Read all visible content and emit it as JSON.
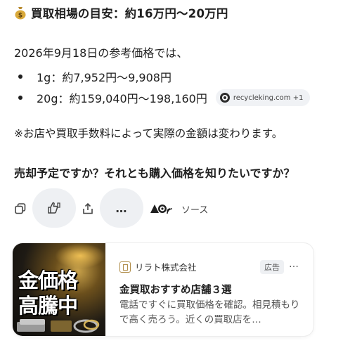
{
  "heading": {
    "icon": "money-bag-icon",
    "text": "買取相場の目安：約16万円～20万円"
  },
  "intro": "2026年9月18日の参考価格では、",
  "bullets": [
    {
      "text": "1g：約7,952円～9,908円"
    },
    {
      "text": "20g：約159,040円～198,160円",
      "source_chip": "recycleking.com +1"
    }
  ],
  "note": "※お店や買取手数料によって実際の金額は変わります。",
  "question": "売却予定ですか？それとも購入価格を知りたいですか？",
  "actions": {
    "copy_icon": "copy-icon",
    "feedback_icon": "thumbs-up-down-icon",
    "share_icon": "share-icon",
    "more_label": "…",
    "source_label": "ソース"
  },
  "ad": {
    "image_text_line1": "金価格",
    "image_text_line2": "高騰中",
    "brand": "リラト株式会社",
    "badge": "広告",
    "menu": "…",
    "title": "金買取おすすめ店舗３選",
    "description": "電話ですぐに買取価格を確認。相見積もりで高く売ろう。近くの買取店を…"
  },
  "colors": {
    "accent_gold": "#c9a24a",
    "pill_bg": "#eef0f3",
    "text": "#1f1f1f"
  }
}
